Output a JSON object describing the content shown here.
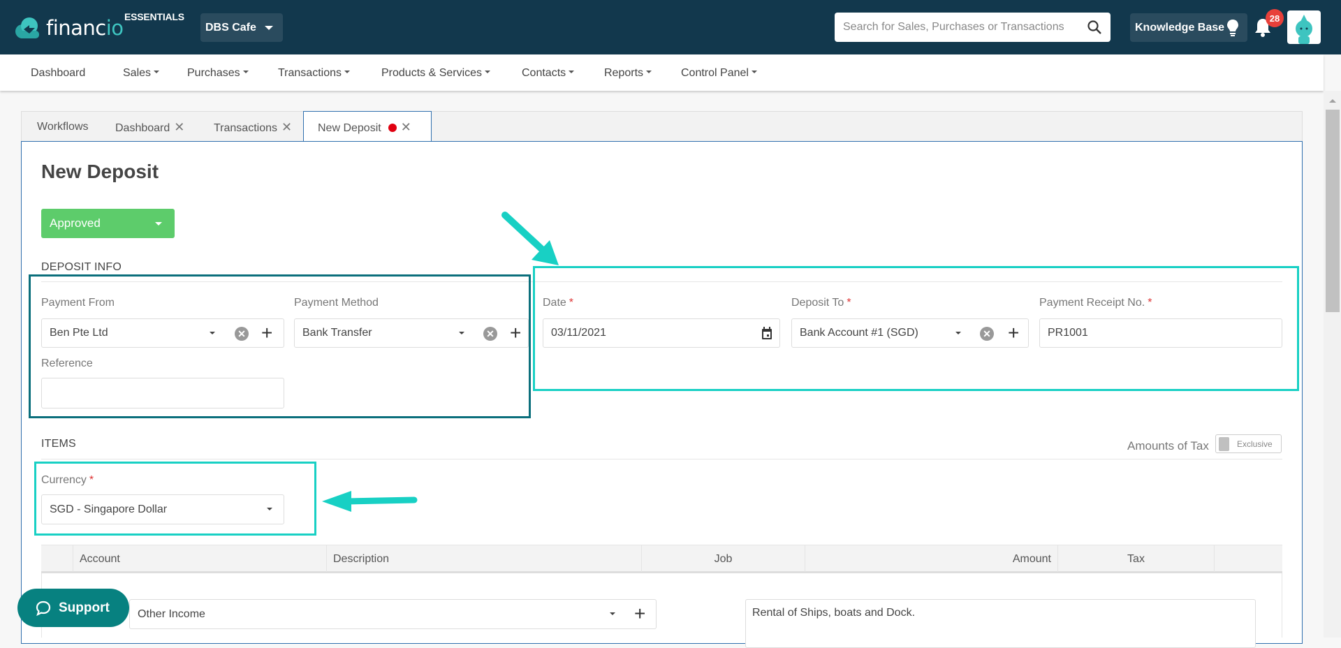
{
  "header": {
    "logo_text_main": "financ",
    "logo_text_accent": "io",
    "edition": "ESSENTIALS",
    "company": "DBS Cafe",
    "search_placeholder": "Search for Sales, Purchases or Transactions",
    "knowledge_base": "Knowledge Base",
    "notification_count": "28"
  },
  "nav": {
    "items": [
      {
        "label": "Dashboard",
        "dropdown": false
      },
      {
        "label": "Sales",
        "dropdown": true
      },
      {
        "label": "Purchases",
        "dropdown": true
      },
      {
        "label": "Transactions",
        "dropdown": true
      },
      {
        "label": "Products & Services",
        "dropdown": true
      },
      {
        "label": "Contacts",
        "dropdown": true
      },
      {
        "label": "Reports",
        "dropdown": true
      },
      {
        "label": "Control Panel",
        "dropdown": true
      }
    ]
  },
  "tabs": [
    {
      "label": "Workflows",
      "closable": false,
      "active": false
    },
    {
      "label": "Dashboard",
      "closable": true,
      "active": false
    },
    {
      "label": "Transactions",
      "closable": true,
      "active": false
    },
    {
      "label": "New Deposit",
      "closable": true,
      "active": true,
      "unsaved": true
    }
  ],
  "page": {
    "title": "New Deposit",
    "status": "Approved",
    "status_color": "#5dcc6b"
  },
  "deposit_info": {
    "section_title": "DEPOSIT INFO",
    "payment_from": {
      "label": "Payment From",
      "value": "Ben Pte Ltd"
    },
    "payment_method": {
      "label": "Payment Method",
      "value": "Bank Transfer"
    },
    "reference": {
      "label": "Reference",
      "value": ""
    },
    "date": {
      "label": "Date",
      "value": "03/11/2021",
      "required": "*"
    },
    "deposit_to": {
      "label": "Deposit To",
      "value": "Bank Account #1 (SGD)",
      "required": "*"
    },
    "receipt_no": {
      "label": "Payment Receipt No.",
      "value": "PR1001",
      "required": "*"
    }
  },
  "items": {
    "section_title": "ITEMS",
    "tax_label": "Amounts of Tax",
    "tax_mode": "Exclusive",
    "currency": {
      "label": "Currency",
      "value": "SGD - Singapore Dollar",
      "required": "*"
    },
    "columns": [
      "",
      "Account",
      "Description",
      "Job",
      "Amount",
      "Tax",
      ""
    ],
    "rows": [
      {
        "account": "Other Income",
        "description": "Rental of Ships, boats and Dock."
      }
    ]
  },
  "support_label": "Support",
  "annotation_colors": {
    "highlight": "#18d0c4",
    "dark_highlight": "#0b6f7c"
  }
}
